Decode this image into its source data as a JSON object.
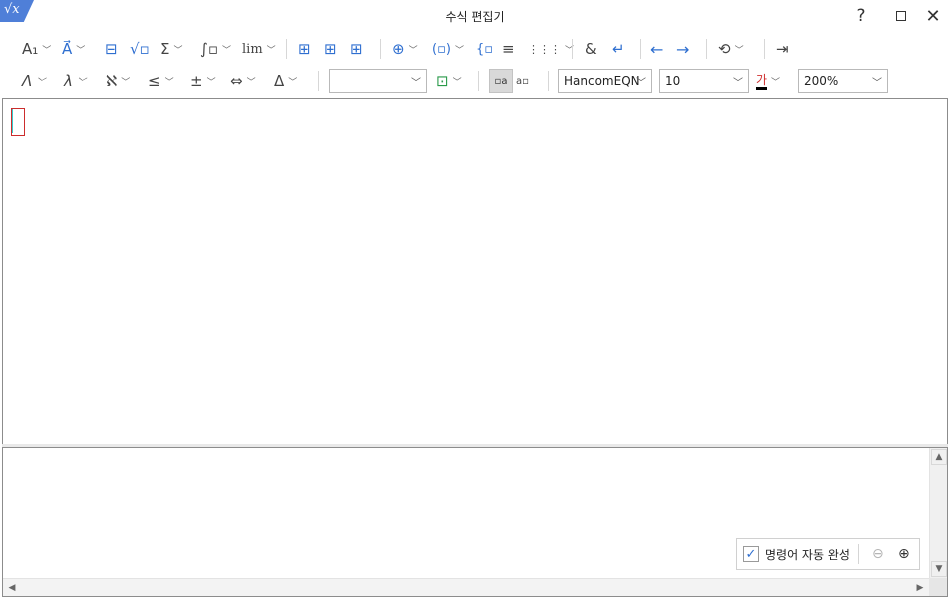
{
  "window": {
    "title": "수식 편집기",
    "logo_glyph": "√x",
    "help_glyph": "?",
    "close_glyph": "✕"
  },
  "toolbar_row1": {
    "items": [
      {
        "name": "subscript-superscript-icon",
        "glyph": "A₁",
        "has_dropdown": true
      },
      {
        "name": "accent-vector-icon",
        "glyph": "A⃗",
        "has_dropdown": true
      },
      {
        "name": "fraction-icon",
        "glyph": "⊟"
      },
      {
        "name": "radical-icon",
        "glyph": "√▫"
      },
      {
        "name": "sum-icon",
        "glyph": "Σ",
        "has_dropdown": true
      },
      {
        "name": "integral-icon",
        "glyph": "∫▫",
        "has_dropdown": true
      },
      {
        "name": "limit-icon",
        "glyph": "lim",
        "has_dropdown": true
      },
      {
        "name": "matrix-structure-icon",
        "glyph": "⊞"
      },
      {
        "name": "matrix-structure-2-icon",
        "glyph": "⊞"
      },
      {
        "name": "matrix-structure-3-icon",
        "glyph": "⊞"
      },
      {
        "name": "stack-icon",
        "glyph": "⊕",
        "has_dropdown": true
      },
      {
        "name": "parenthesis-icon",
        "glyph": "(▫)",
        "has_dropdown": true
      },
      {
        "name": "case-bracket-icon",
        "glyph": "{▫"
      },
      {
        "name": "line-icon",
        "glyph": "≡"
      },
      {
        "name": "matrix-grid-icon",
        "glyph": "⋮⋮⋮",
        "has_dropdown": true
      },
      {
        "name": "ampersand-icon",
        "glyph": "&"
      },
      {
        "name": "enter-icon",
        "glyph": "↵"
      },
      {
        "name": "arrow-left-icon",
        "glyph": "←"
      },
      {
        "name": "arrow-right-icon",
        "glyph": "→"
      },
      {
        "name": "convert-icon",
        "glyph": "⟲",
        "has_dropdown": true
      },
      {
        "name": "insert-exit-icon",
        "glyph": "⇥"
      }
    ]
  },
  "toolbar_row2": {
    "items": [
      {
        "name": "greek-capital-icon",
        "glyph": "Λ",
        "has_dropdown": true
      },
      {
        "name": "greek-small-icon",
        "glyph": "λ",
        "has_dropdown": true
      },
      {
        "name": "hebrew-symbol-icon",
        "glyph": "ℵ",
        "has_dropdown": true
      },
      {
        "name": "relation-icon",
        "glyph": "≤",
        "has_dropdown": true
      },
      {
        "name": "operator-icon",
        "glyph": "±",
        "has_dropdown": true
      },
      {
        "name": "arrow-symbol-icon",
        "glyph": "⇔",
        "has_dropdown": true
      },
      {
        "name": "misc-symbol-icon",
        "glyph": "Δ",
        "has_dropdown": true
      }
    ],
    "style_combo_value": "",
    "font_combo_value": "HancomEQN",
    "size_combo_value": "10",
    "color_glyph": "가",
    "zoom_combo_value": "200%"
  },
  "script_panel": {
    "autocomplete_label": "명령어 자동 완성",
    "autocomplete_checked": true
  },
  "colors": {
    "accent": "#2f6fd0",
    "caret_border": "#cc2d2d",
    "logo": "#4f7fd8"
  }
}
